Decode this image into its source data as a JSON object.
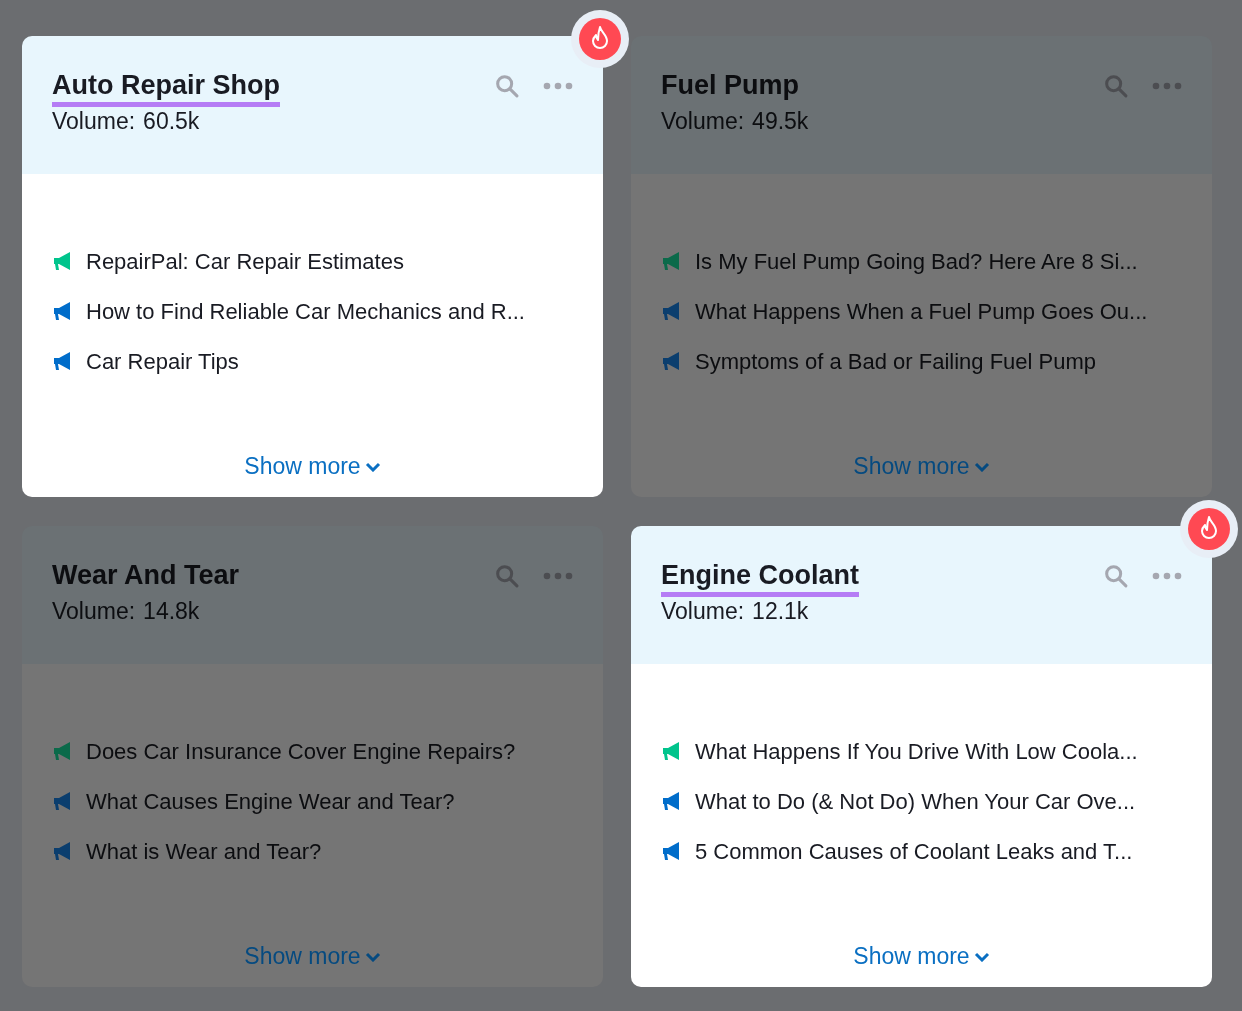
{
  "cards": [
    {
      "title": "Auto Repair Shop",
      "volume_label": "Volume:",
      "volume": "60.5k",
      "highlighted": true,
      "hot": true,
      "items": [
        {
          "text": "RepairPal: Car Repair Estimates",
          "color": "#00c48c"
        },
        {
          "text": "How to Find Reliable Car Mechanics and R...",
          "color": "#006dca"
        },
        {
          "text": "Car Repair Tips",
          "color": "#006dca"
        }
      ],
      "show_more": "Show more"
    },
    {
      "title": "Fuel Pump",
      "volume_label": "Volume:",
      "volume": "49.5k",
      "highlighted": false,
      "hot": false,
      "items": [
        {
          "text": "Is My Fuel Pump Going Bad? Here Are 8 Si...",
          "color": "#0b6a4a"
        },
        {
          "text": "What Happens When a Fuel Pump Goes Ou...",
          "color": "#0b3e6e"
        },
        {
          "text": "Symptoms of a Bad or Failing Fuel Pump",
          "color": "#0b3e6e"
        }
      ],
      "show_more": "Show more"
    },
    {
      "title": "Wear And Tear",
      "volume_label": "Volume:",
      "volume": "14.8k",
      "highlighted": false,
      "hot": false,
      "items": [
        {
          "text": "Does Car Insurance Cover Engine Repairs?",
          "color": "#0b6a4a"
        },
        {
          "text": "What Causes Engine Wear and Tear?",
          "color": "#0b3e6e"
        },
        {
          "text": "What is Wear and Tear?",
          "color": "#0b3e6e"
        }
      ],
      "show_more": "Show more"
    },
    {
      "title": "Engine Coolant",
      "volume_label": "Volume:",
      "volume": "12.1k",
      "highlighted": true,
      "hot": true,
      "items": [
        {
          "text": "What Happens If You Drive With Low Coola...",
          "color": "#00c48c"
        },
        {
          "text": "What to Do (& Not Do) When Your Car Ove...",
          "color": "#006dca"
        },
        {
          "text": "5 Common Causes of Coolant Leaks and T...",
          "color": "#006dca"
        }
      ],
      "show_more": "Show more"
    }
  ]
}
